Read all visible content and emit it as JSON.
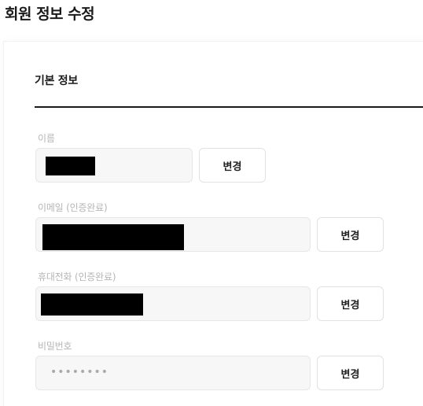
{
  "header": {
    "title": "회원 정보 수정"
  },
  "section": {
    "title": "기본 정보"
  },
  "fields": {
    "name": {
      "label": "이름",
      "button_label": "변경"
    },
    "email": {
      "label": "이메일 (인증완료)",
      "button_label": "변경"
    },
    "phone": {
      "label": "휴대전화 (인증완료)",
      "button_label": "변경"
    },
    "password": {
      "label": "비밀번호",
      "value_masked": "••••••••",
      "button_label": "변경"
    }
  }
}
